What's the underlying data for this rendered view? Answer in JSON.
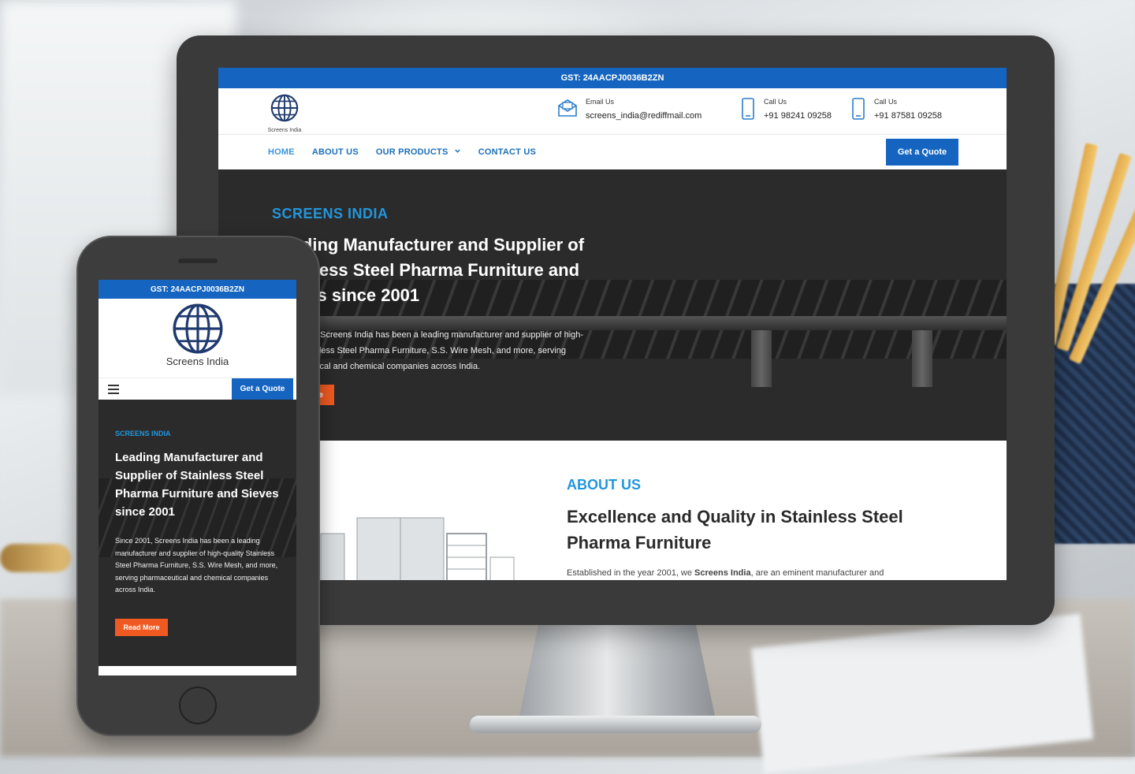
{
  "desktop": {
    "gst": "GST: 24AACPJ0036B2ZN",
    "logo_text": "Screens India",
    "email": {
      "label": "Email Us",
      "value": "screens_india@rediffmail.com"
    },
    "call1": {
      "label": "Call Us",
      "value": "+91 98241 09258"
    },
    "call2": {
      "label": "Call Us",
      "value": "+91 87581 09258"
    },
    "nav": {
      "home": "HOME",
      "about": "ABOUT US",
      "products": "OUR PRODUCTS",
      "contact": "CONTACT US",
      "quote": "Get a Quote"
    },
    "hero": {
      "kicker": "SCREENS INDIA",
      "title": "Leading Manufacturer and Supplier of Stainless Steel Pharma Furniture and Sieves since 2001",
      "text": "Since 2001, Screens India has been a leading manufacturer and supplier of high-quality Stainless Steel Pharma Furniture, S.S. Wire Mesh, and more, serving pharmaceutical and chemical companies across India.",
      "button": "Read More"
    },
    "about": {
      "kicker": "ABOUT US",
      "title": "Excellence and Quality in Stainless Steel Pharma Furniture",
      "text_prefix": "Established in the year 2001, we ",
      "text_bold": "Screens India",
      "text_suffix": ", are an eminent manufacturer and"
    }
  },
  "mobile": {
    "gst": "GST: 24AACPJ0036B2ZN",
    "logo_text": "Screens India",
    "quote": "Get a Quote",
    "hero": {
      "kicker": "SCREENS INDIA",
      "title": "Leading Manufacturer and Supplier of Stainless Steel Pharma Furniture and Sieves since 2001",
      "text": "Since 2001, Screens India has been a leading manufacturer and supplier of high-quality Stainless Steel Pharma Furniture, S.S. Wire Mesh, and more, serving pharmaceutical and chemical companies across India.",
      "button": "Read More"
    }
  },
  "colors": {
    "brand_blue": "#1565c0",
    "accent_blue": "#2296dc",
    "orange": "#f05a22",
    "dark": "#2b2b2b"
  },
  "icons": [
    "globe-icon",
    "mail-icon",
    "phone-icon",
    "chevron-down-icon",
    "hamburger-icon"
  ]
}
